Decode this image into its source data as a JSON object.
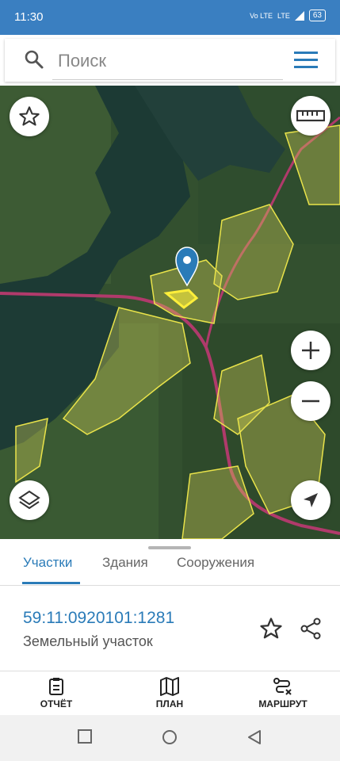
{
  "status": {
    "time": "11:30",
    "network1": "Vo LTE",
    "network2": "LTE",
    "battery": "63"
  },
  "search": {
    "placeholder": "Поиск"
  },
  "sheet": {
    "tabs": [
      {
        "label": "Участки",
        "active": true
      },
      {
        "label": "Здания",
        "active": false
      },
      {
        "label": "Сооружения",
        "active": false
      }
    ],
    "cadastral_number": "59:11:0920101:1281",
    "object_type": "Земельный участок"
  },
  "bottom_nav": [
    {
      "label": "ОТЧЁТ",
      "icon": "report-icon"
    },
    {
      "label": "ПЛАН",
      "icon": "map-plan-icon"
    },
    {
      "label": "МАРШРУТ",
      "icon": "route-icon"
    }
  ],
  "colors": {
    "accent": "#2a7bb8",
    "status_bar": "#3a7fc1",
    "parcel_outline": "#e9e34a",
    "road": "#b03a6b"
  }
}
